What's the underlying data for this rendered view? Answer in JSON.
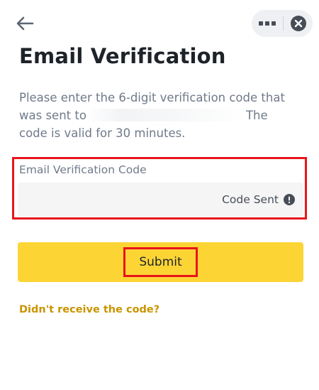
{
  "header": {
    "back_icon": "arrow-left-icon",
    "more_icon": "more-horizontal-icon",
    "close_icon": "close-circle-icon"
  },
  "page": {
    "title": "Email Verification",
    "description_line1": "Please enter the 6-digit verification code that",
    "description_line2_start": "was sent to",
    "description_line2_end": "The",
    "description_line3": "code is valid for 30 minutes."
  },
  "field": {
    "label": "Email Verification Code",
    "value": "",
    "status": "Code Sent",
    "status_icon": "info-circle-icon"
  },
  "actions": {
    "submit_label": "Submit",
    "resend_link": "Didn't receive the code?"
  },
  "colors": {
    "accent_yellow": "#fcd535",
    "link_gold": "#c99400",
    "highlight_red": "#e8141b",
    "title_text": "#1e2329",
    "secondary_text": "#707a8a"
  }
}
